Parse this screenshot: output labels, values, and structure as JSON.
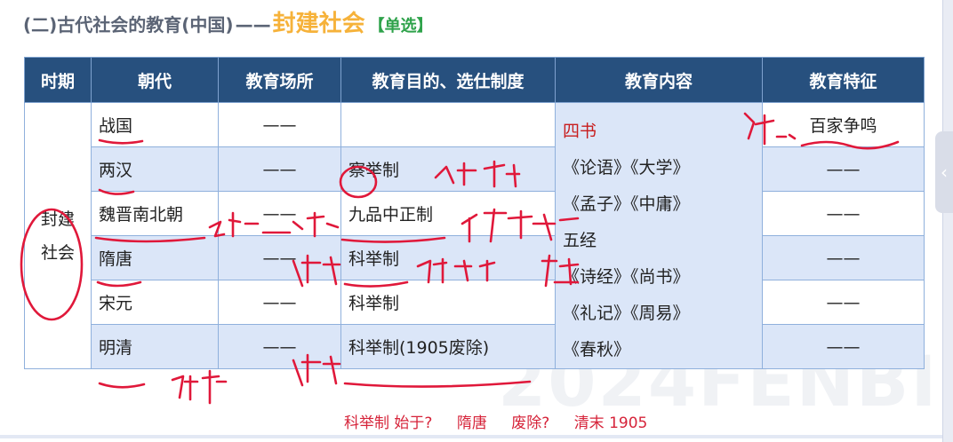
{
  "heading": {
    "main": "(二)古代社会的教育(中国)",
    "dash": "——",
    "accent": "封建社会",
    "tag": "【单选】"
  },
  "table": {
    "headers": [
      "时期",
      "朝代",
      "教育场所",
      "教育目的、选仕制度",
      "教育内容",
      "教育特征"
    ],
    "era_label": [
      "封建",
      "社会"
    ],
    "rows": [
      {
        "dynasty": "战国",
        "place": "——",
        "aim": "",
        "feature": "百家争鸣"
      },
      {
        "dynasty": "两汉",
        "place": "——",
        "aim": "察举制",
        "feature": "——"
      },
      {
        "dynasty": "魏晋南北朝",
        "place": "——",
        "aim": "九品中正制",
        "feature": "——"
      },
      {
        "dynasty": "隋唐",
        "place": "——",
        "aim": "科举制",
        "feature": "——"
      },
      {
        "dynasty": "宋元",
        "place": "——",
        "aim": "科举制",
        "feature": "——"
      },
      {
        "dynasty": "明清",
        "place": "——",
        "aim": "科举制(1905废除)",
        "feature": "——"
      }
    ],
    "content": [
      "四书",
      "《论语》《大学》",
      "《孟子》《中庸》",
      "五经",
      "《诗经》《尚书》",
      "《礼记》《周易》",
      "《春秋》"
    ]
  },
  "footer": {
    "q1": "科举制 始于?",
    "a1": "隋唐",
    "q2": "废除?",
    "a2": "清末 1905"
  },
  "watermark": "2024FENBI",
  "colors": {
    "header_bg": "#27507e",
    "accent_gold": "#f6b23a",
    "tag_green": "#2ea24a",
    "highlight_red": "#c81e1e",
    "row_blue": "#dbe6f8",
    "ink_red": "#e0183a"
  },
  "icons": {
    "side_tab": "chevron-left-icon"
  }
}
